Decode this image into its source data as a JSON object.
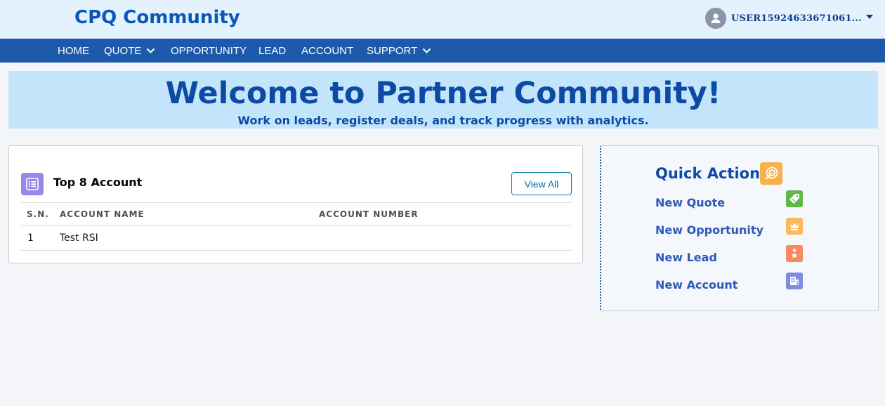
{
  "header": {
    "brand": "CPQ Community",
    "user_name": "USER15924633671061...",
    "icons": {
      "avatar": "user-avatar-icon",
      "dropdown": "caret-down-icon"
    }
  },
  "nav": {
    "items": [
      {
        "label": "HOME",
        "has_dropdown": false
      },
      {
        "label": "QUOTE",
        "has_dropdown": true
      },
      {
        "label": "OPPORTUNITY",
        "has_dropdown": false
      },
      {
        "label": "LEAD",
        "has_dropdown": false
      },
      {
        "label": "ACCOUNT",
        "has_dropdown": false
      },
      {
        "label": "SUPPORT",
        "has_dropdown": true
      }
    ]
  },
  "banner": {
    "title": "Welcome to Partner Community!",
    "subtitle": "Work on leads, register deals, and track progress with analytics."
  },
  "accounts": {
    "title": "Top 8 Account",
    "view_all_label": "View All",
    "columns": [
      "S.N.",
      "ACCOUNT NAME",
      "ACCOUNT NUMBER"
    ],
    "rows": [
      {
        "sn": "1",
        "name": "Test RSI",
        "number": ""
      }
    ]
  },
  "quick_action": {
    "title": "Quick Action",
    "items": [
      {
        "label": "New Quote",
        "icon": "tag-icon",
        "color": "#62b846"
      },
      {
        "label": "New Opportunity",
        "icon": "crown-icon",
        "color": "#fcb95b"
      },
      {
        "label": "New Lead",
        "icon": "person-star-icon",
        "color": "#f88962"
      },
      {
        "label": "New Account",
        "icon": "building-icon",
        "color": "#7f8de1"
      }
    ]
  },
  "colors": {
    "brand_blue": "#0b57b8",
    "nav_blue": "#1d5aab",
    "banner_bg": "#c2e5fb",
    "header_bg": "#e3f2fd"
  }
}
